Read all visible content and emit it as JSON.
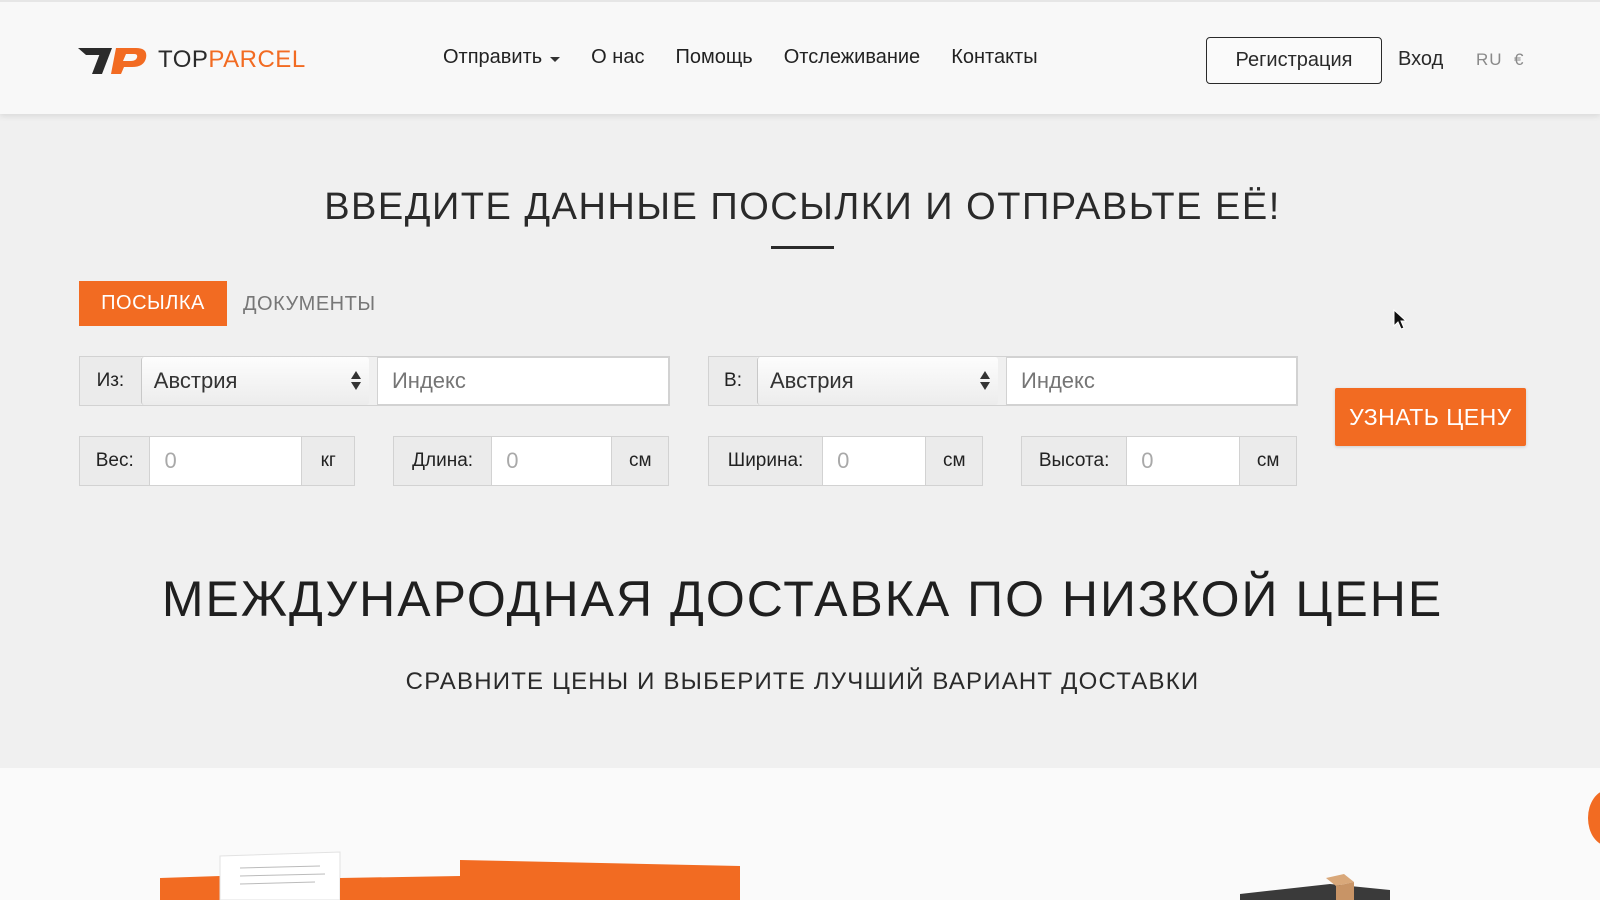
{
  "header": {
    "logo": {
      "top": "TOP",
      "parcel": "PARCEL"
    },
    "nav": [
      {
        "label": "Отправить",
        "has_dropdown": true
      },
      {
        "label": "О нас"
      },
      {
        "label": "Помощь"
      },
      {
        "label": "Отслеживание"
      },
      {
        "label": "Контакты"
      }
    ],
    "register_label": "Регистрация",
    "login_label": "Вход",
    "language": "RU",
    "currency": "€"
  },
  "hero": {
    "title": "ВВЕДИТЕ ДАННЫЕ ПОСЫЛКИ И ОТПРАВЬТЕ ЕЁ!",
    "tabs": {
      "parcel": "ПОСЫЛКА",
      "documents": "ДОКУМЕНТЫ"
    },
    "from": {
      "label": "Из:",
      "country": "Австрия",
      "zip_placeholder": "Индекс"
    },
    "to": {
      "label": "В:",
      "country": "Австрия",
      "zip_placeholder": "Индекс"
    },
    "weight": {
      "label": "Вес:",
      "value": "0",
      "unit": "кг"
    },
    "length": {
      "label": "Длина:",
      "value": "0",
      "unit": "см"
    },
    "width": {
      "label": "Ширина:",
      "value": "0",
      "unit": "см"
    },
    "height": {
      "label": "Высота:",
      "value": "0",
      "unit": "см"
    },
    "cta_label": "УЗНАТЬ ЦЕНУ"
  },
  "promo": {
    "title": "МЕЖДУНАРОДНАЯ ДОСТАВКА ПО НИЗКОЙ ЦЕНЕ",
    "subtitle": "СРАВНИТЕ ЦЕНЫ И ВЫБЕРИТЕ ЛУЧШИЙ ВАРИАНТ ДОСТАВКИ"
  },
  "colors": {
    "accent": "#f26b22",
    "text": "#2a2a2a",
    "background": "#f0f0f0"
  }
}
